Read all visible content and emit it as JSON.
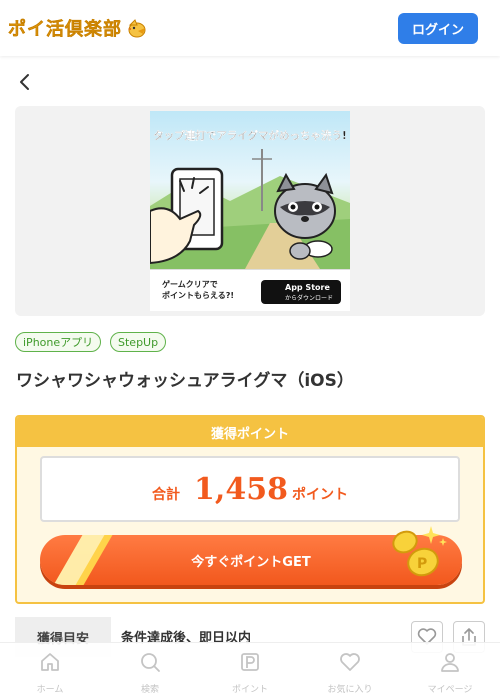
{
  "header": {
    "logo_text": "ポイ活倶楽部",
    "login_label": "ログイン"
  },
  "banner": {
    "caption": "タップ連打でアライグマがめっちゃ洗う!",
    "promo_line1": "ゲームクリアで",
    "promo_line2": "ポイントもらえる?!",
    "appstore_name": "App Store",
    "appstore_sub": "からダウンロード"
  },
  "tags": [
    "iPhoneアプリ",
    "StepUp"
  ],
  "app_title": "ワシャワシャウォッシュアライグマ（iOS）",
  "points": {
    "header": "獲得ポイント",
    "total_label": "合計",
    "total_value": "1,458",
    "unit": "ポイント",
    "get_button": "今すぐポイントGET"
  },
  "info": {
    "label": "獲得目安",
    "value": "条件達成後、即日以内"
  },
  "tabbar": {
    "items": [
      {
        "label": "ホーム",
        "icon": "home-icon"
      },
      {
        "label": "検索",
        "icon": "search-icon"
      },
      {
        "label": "ポイント",
        "icon": "point-icon"
      },
      {
        "label": "お気に入り",
        "icon": "heart-icon"
      },
      {
        "label": "マイページ",
        "icon": "user-icon"
      }
    ]
  },
  "colors": {
    "brand_orange": "#f25a1e",
    "gold": "#f5c242",
    "login_blue": "#2f7ee8",
    "tag_green": "#5fb24a"
  }
}
